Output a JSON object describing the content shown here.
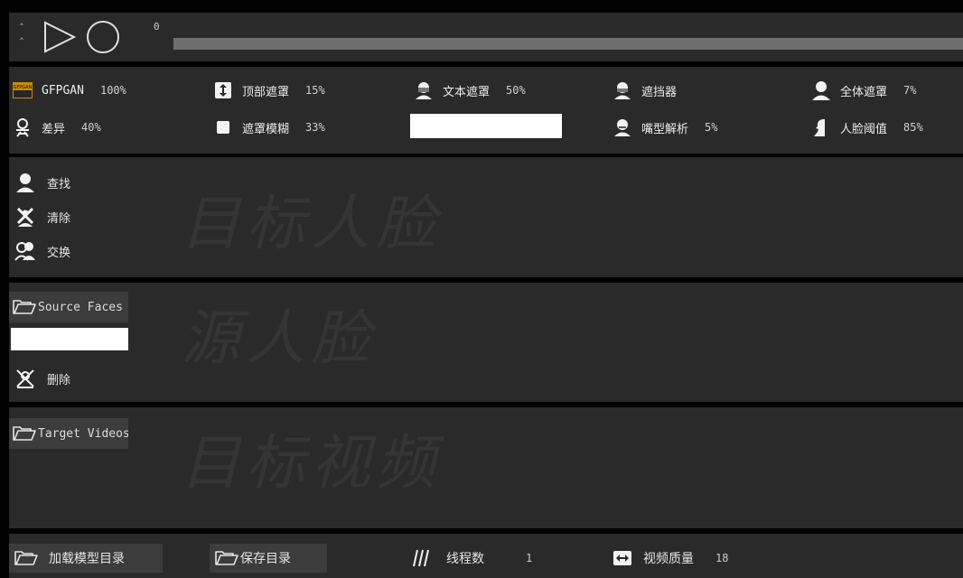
{
  "transport": {
    "up_arrow": "˄",
    "down_arrow": "˄",
    "frame": "0"
  },
  "params": {
    "gfpgan": {
      "label": "GFPGAN",
      "value": "100%",
      "icon": "gfpgan-logo-icon",
      "logo_text": "GFPGAN"
    },
    "top_mask": {
      "label": "顶部遮罩",
      "value": "15%",
      "icon": "vertical-arrows-icon"
    },
    "text_mask": {
      "label": "文本遮罩",
      "value": "50%",
      "icon": "masked-face-icon"
    },
    "occluder": {
      "label": "遮挡器",
      "value": "",
      "icon": "masked-face-icon"
    },
    "full_mask": {
      "label": "全体遮罩",
      "value": "7%",
      "icon": "person-icon"
    },
    "diff": {
      "label": "差异",
      "value": "40%",
      "icon": "face-diff-icon"
    },
    "mask_blur": {
      "label": "遮罩模糊",
      "value": "33%",
      "icon": "square-icon"
    },
    "text_input": {
      "value": ""
    },
    "mouth_parse": {
      "label": "嘴型解析",
      "value": "5%",
      "icon": "face-mouth-icon"
    },
    "face_threshold": {
      "label": "人脸阈值",
      "value": "85%",
      "icon": "face-profile-icon"
    }
  },
  "target_faces": {
    "watermark": "目标人脸",
    "find": "查找",
    "clear": "清除",
    "swap": "交换"
  },
  "source_faces": {
    "watermark": "源人脸",
    "button": "Source Faces",
    "input_value": "",
    "delete": "删除"
  },
  "target_video": {
    "watermark": "目标视频",
    "button": "Target Videos"
  },
  "bottom": {
    "load_models": "加载模型目录",
    "save_dir": "保存目录",
    "threads_label": "线程数",
    "threads_value": "1",
    "quality_label": "视频质量",
    "quality_value": "18"
  }
}
